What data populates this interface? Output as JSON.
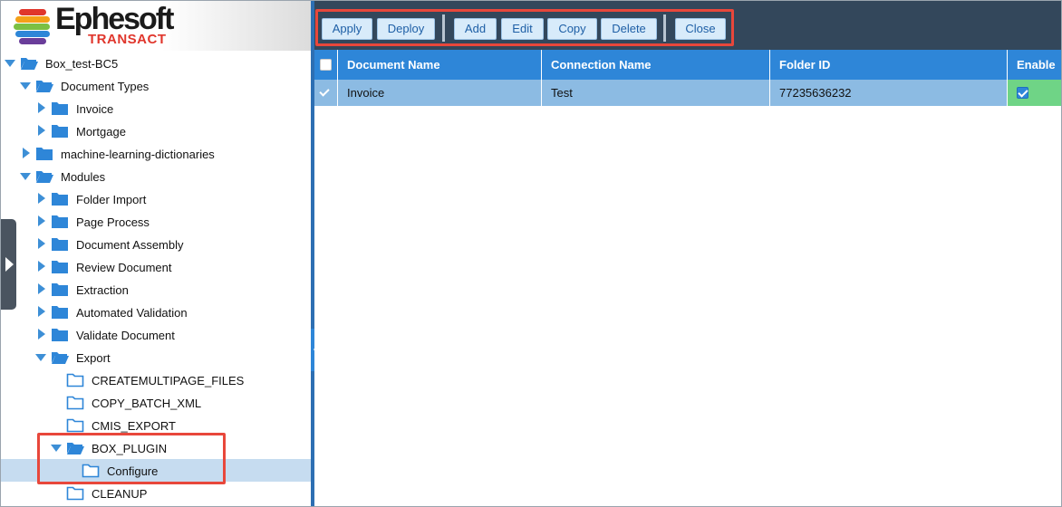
{
  "logo": {
    "brand": "Ephesoft",
    "product": "TRANSACT",
    "colors": [
      "#e0362c",
      "#f4a019",
      "#7bc043",
      "#2e86d8",
      "#6a3d9a"
    ]
  },
  "tree": {
    "nodes": [
      {
        "label": "Box_test-BC5",
        "state": "open",
        "icon": "folder-open-icon"
      },
      {
        "label": "Document Types",
        "state": "open",
        "icon": "folder-open-icon"
      },
      {
        "label": "Invoice",
        "state": "closed",
        "icon": "folder-icon"
      },
      {
        "label": "Mortgage",
        "state": "closed",
        "icon": "folder-icon"
      },
      {
        "label": "machine-learning-dictionaries",
        "state": "closed",
        "icon": "folder-icon"
      },
      {
        "label": "Modules",
        "state": "open",
        "icon": "folder-open-icon"
      },
      {
        "label": "Folder Import",
        "state": "closed",
        "icon": "folder-icon"
      },
      {
        "label": "Page Process",
        "state": "closed",
        "icon": "folder-icon"
      },
      {
        "label": "Document Assembly",
        "state": "closed",
        "icon": "folder-icon"
      },
      {
        "label": "Review Document",
        "state": "closed",
        "icon": "folder-icon"
      },
      {
        "label": "Extraction",
        "state": "closed",
        "icon": "folder-icon"
      },
      {
        "label": "Automated Validation",
        "state": "closed",
        "icon": "folder-icon"
      },
      {
        "label": "Validate Document",
        "state": "closed",
        "icon": "folder-icon"
      },
      {
        "label": "Export",
        "state": "open",
        "icon": "folder-open-icon"
      },
      {
        "label": "CREATEMULTIPAGE_FILES",
        "state": "leaf",
        "icon": "folder-outline-icon"
      },
      {
        "label": "COPY_BATCH_XML",
        "state": "leaf",
        "icon": "folder-outline-icon"
      },
      {
        "label": "CMIS_EXPORT",
        "state": "leaf",
        "icon": "folder-outline-icon"
      },
      {
        "label": "BOX_PLUGIN",
        "state": "open",
        "icon": "folder-open-icon"
      },
      {
        "label": "Configure",
        "state": "leaf",
        "icon": "folder-outline-icon",
        "selected": true
      },
      {
        "label": "CLEANUP",
        "state": "leaf",
        "icon": "folder-outline-icon"
      }
    ]
  },
  "toolbar": {
    "apply": "Apply",
    "deploy": "Deploy",
    "add": "Add",
    "edit": "Edit",
    "copy": "Copy",
    "delete": "Delete",
    "close": "Close"
  },
  "grid": {
    "columns": [
      "Document Name",
      "Connection Name",
      "Folder ID",
      "Enable"
    ],
    "rows": [
      {
        "document_name": "Invoice",
        "connection_name": "Test",
        "folder_id": "77235636232",
        "enable": true,
        "selected": true
      }
    ]
  },
  "colors": {
    "accent": "#2e86d8",
    "toolbar_bg": "#33475b",
    "highlight": "#e8473b",
    "row_selected": "#8cbbe3",
    "enable_cell": "#6fd486"
  }
}
